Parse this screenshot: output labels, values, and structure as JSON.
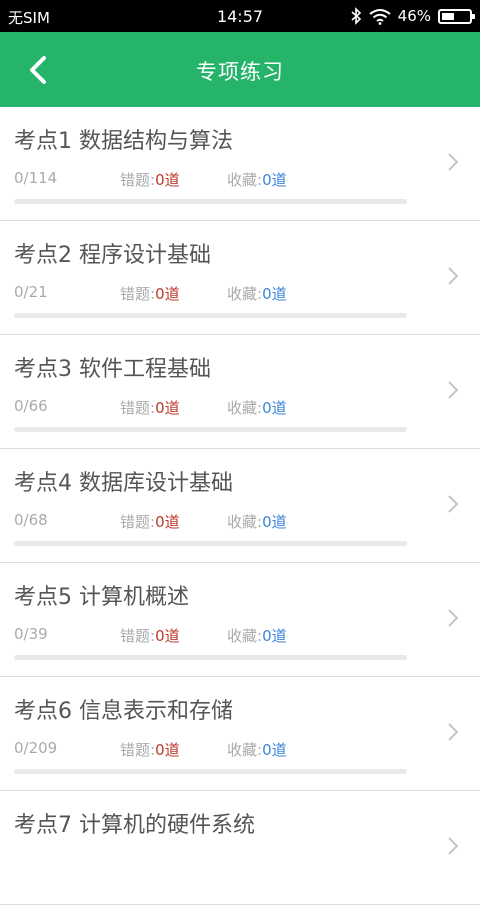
{
  "status": {
    "carrier": "无SIM",
    "time": "14:57",
    "battery": "46%",
    "battery_level": 0.46
  },
  "header": {
    "title": "专项练习"
  },
  "items": [
    {
      "name": "考点1 数据结构与算法",
      "progress": "0/114",
      "err_label": "错题:",
      "err_value": "0道",
      "fav_label": "收藏:",
      "fav_value": "0道",
      "done_fraction": 0
    },
    {
      "name": "考点2 程序设计基础",
      "progress": "0/21",
      "err_label": "错题:",
      "err_value": "0道",
      "fav_label": "收藏:",
      "fav_value": "0道",
      "done_fraction": 0
    },
    {
      "name": "考点3 软件工程基础",
      "progress": "0/66",
      "err_label": "错题:",
      "err_value": "0道",
      "fav_label": "收藏:",
      "fav_value": "0道",
      "done_fraction": 0
    },
    {
      "name": "考点4 数据库设计基础",
      "progress": "0/68",
      "err_label": "错题:",
      "err_value": "0道",
      "fav_label": "收藏:",
      "fav_value": "0道",
      "done_fraction": 0
    },
    {
      "name": "考点5 计算机概述",
      "progress": "0/39",
      "err_label": "错题:",
      "err_value": "0道",
      "fav_label": "收藏:",
      "fav_value": "0道",
      "done_fraction": 0
    },
    {
      "name": "考点6 信息表示和存储",
      "progress": "0/209",
      "err_label": "错题:",
      "err_value": "0道",
      "fav_label": "收藏:",
      "fav_value": "0道",
      "done_fraction": 0
    },
    {
      "name": "考点7 计算机的硬件系统"
    }
  ]
}
